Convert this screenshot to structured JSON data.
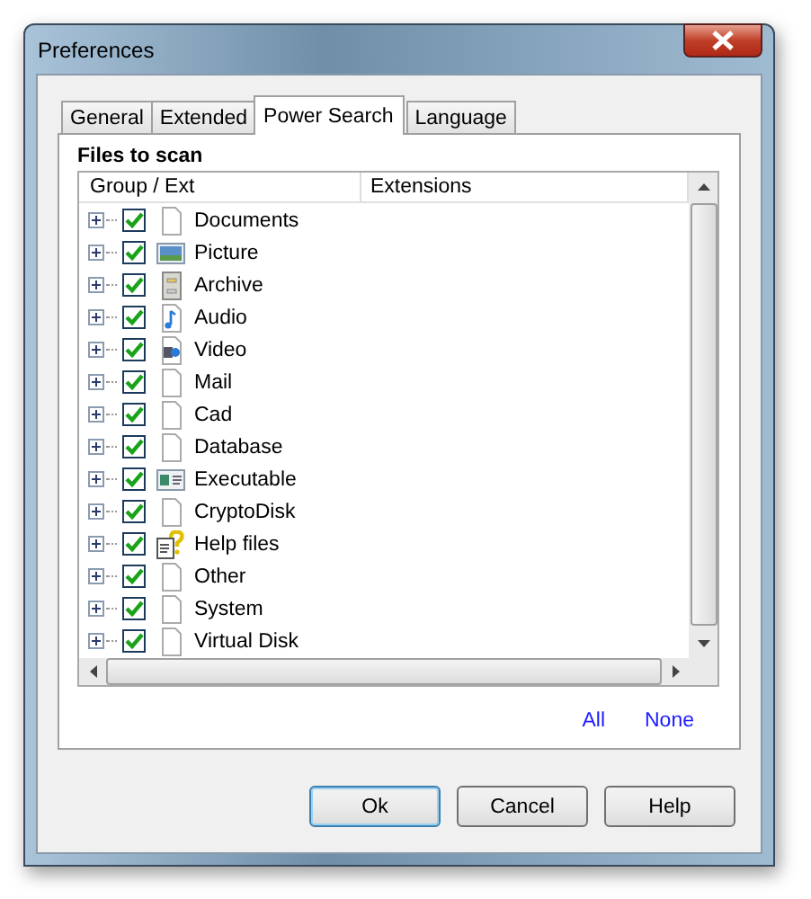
{
  "window": {
    "title": "Preferences"
  },
  "tabs": [
    {
      "label": "General",
      "selected": false
    },
    {
      "label": "Extended",
      "selected": false
    },
    {
      "label": "Power Search",
      "selected": true
    },
    {
      "label": "Language",
      "selected": false
    }
  ],
  "section_title": "Files to scan",
  "table": {
    "columns": [
      "Group / Ext",
      "Extensions"
    ],
    "rows": [
      {
        "label": "Documents",
        "kind": "document",
        "checked": true,
        "expanded": false
      },
      {
        "label": "Picture",
        "kind": "picture",
        "checked": true,
        "expanded": false
      },
      {
        "label": "Archive",
        "kind": "archive",
        "checked": true,
        "expanded": false
      },
      {
        "label": "Audio",
        "kind": "audio",
        "checked": true,
        "expanded": false
      },
      {
        "label": "Video",
        "kind": "video",
        "checked": true,
        "expanded": false
      },
      {
        "label": "Mail",
        "kind": "document",
        "checked": true,
        "expanded": false
      },
      {
        "label": "Cad",
        "kind": "document",
        "checked": true,
        "expanded": false
      },
      {
        "label": "Database",
        "kind": "document",
        "checked": true,
        "expanded": false
      },
      {
        "label": "Executable",
        "kind": "executable",
        "checked": true,
        "expanded": false
      },
      {
        "label": "CryptoDisk",
        "kind": "document",
        "checked": true,
        "expanded": false
      },
      {
        "label": "Help files",
        "kind": "help",
        "checked": true,
        "expanded": false
      },
      {
        "label": "Other",
        "kind": "document",
        "checked": true,
        "expanded": false
      },
      {
        "label": "System",
        "kind": "document",
        "checked": true,
        "expanded": false
      },
      {
        "label": "Virtual Disk",
        "kind": "document",
        "checked": true,
        "expanded": false
      }
    ]
  },
  "links": [
    "All",
    "None"
  ],
  "buttons": [
    {
      "label": "Ok",
      "selected": true
    },
    {
      "label": "Cancel",
      "selected": false
    },
    {
      "label": "Help",
      "selected": false
    }
  ]
}
